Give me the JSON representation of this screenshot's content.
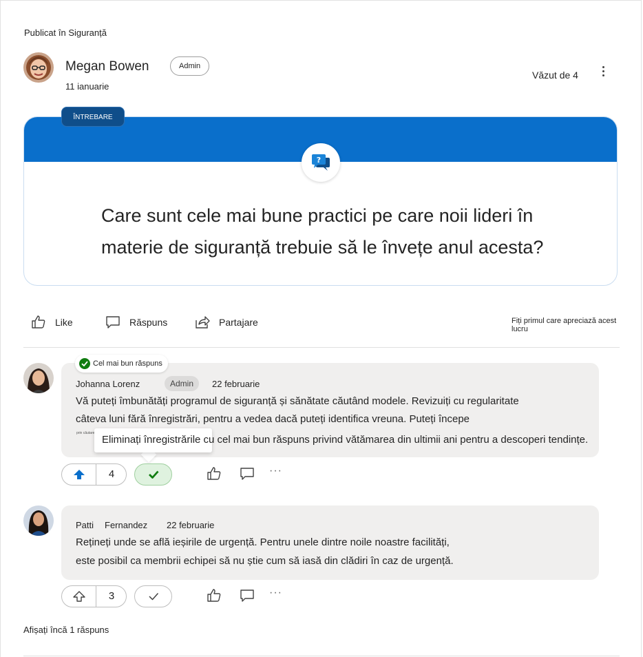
{
  "post": {
    "posted_in": "Publicat în Siguranță",
    "author": "Megan Bowen",
    "role": "Admin",
    "date": "11 ianuarie",
    "seen_by": "Văzut de 4"
  },
  "question": {
    "tag": "ÎNTREBARE",
    "text": "Care sunt cele mai bune practici pe care noii lideri în materie de siguranță trebuie să le învețe anul acesta?",
    "band_color": "#0a6fcb"
  },
  "actions": {
    "like": "Like",
    "reply": "Răspuns",
    "share": "Partajare",
    "first_like": "Fiți primul care apreciază acest lucru"
  },
  "replies": [
    {
      "best_answer_label": "Cel mai bun răspuns",
      "author": "Johanna Lorenz",
      "role": "Admin",
      "date": "22 februarie",
      "line1": "Vă puteți îmbunătăți programul de siguranță și sănătate căutând modele. Revizuiți cu regularitate",
      "line2": "câteva luni fără înregistrări, pentru a vedea dacă puteți identifica vreuna. Puteți începe",
      "tiny": "prin căutarea",
      "line3": "Eliminați înregistrările cu cel mai bun răspuns privind vătămarea din ultimii ani pentru a descoperi tendințe.",
      "votes": "4",
      "accepted": true
    },
    {
      "author_first": "Patti",
      "author_last": "Fernandez",
      "date": "22 februarie",
      "line1": "Rețineți unde se află ieșirile de urgență. Pentru unele dintre noile noastre facilități,",
      "line2": "este posibil ca membrii echipei să nu știe cum să iasă din clădiri în caz de urgență.",
      "votes": "3",
      "accepted": false
    }
  ],
  "more_ellipsis": "···",
  "show_more": "Afișați încă 1 răspuns",
  "colors": {
    "accent": "#0a6fcb",
    "accepted_green": "#107c10",
    "bubble": "#f0efee"
  }
}
